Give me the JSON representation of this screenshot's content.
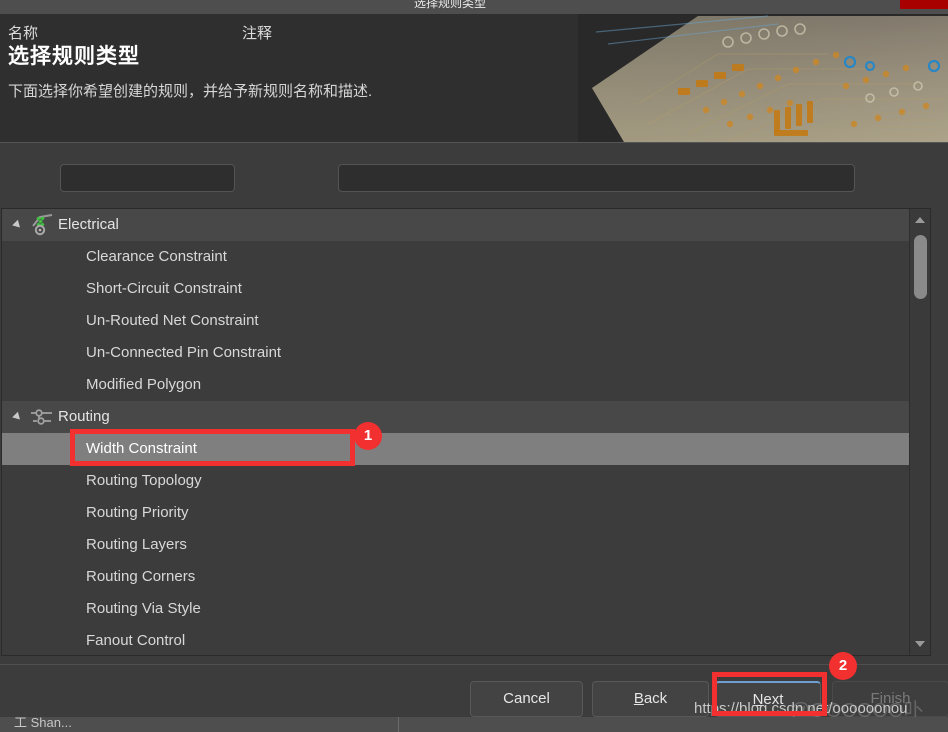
{
  "window": {
    "title": "选择规则类型",
    "close_icon": "close-icon"
  },
  "header": {
    "title": "选择规则类型",
    "subtitle": "下面选择你希望创建的规则，并给予新规则名称和描述.",
    "banner_icon": "pcb-circuit-board-image"
  },
  "fields": {
    "name_label": "名称",
    "name_value": "",
    "name_placeholder": "",
    "comment_label": "注释",
    "comment_value": "",
    "comment_placeholder": ""
  },
  "tree": {
    "groups": [
      {
        "label": "Electrical",
        "icon": "electrical-rule-icon",
        "expander_icon": "triangle-expanded-icon",
        "items": [
          "Clearance Constraint",
          "Short-Circuit Constraint",
          "Un-Routed Net Constraint",
          "Un-Connected Pin Constraint",
          "Modified Polygon"
        ]
      },
      {
        "label": "Routing",
        "icon": "routing-rule-icon",
        "expander_icon": "triangle-expanded-icon",
        "items": [
          "Width Constraint",
          "Routing Topology",
          "Routing Priority",
          "Routing Layers",
          "Routing Corners",
          "Routing Via Style",
          "Fanout Control"
        ]
      }
    ],
    "selected_item": "Width Constraint",
    "scrollbar": {
      "up_icon": "scroll-up-arrow-icon",
      "down_icon": "scroll-down-arrow-icon"
    }
  },
  "footer": {
    "cancel": "Cancel",
    "back_prefix": "",
    "back_accel": "B",
    "back_rest": "ack",
    "next_prefix": "",
    "next_accel": "N",
    "next_rest": "ext",
    "finish": "Finish"
  },
  "annotations": [
    {
      "badge": "1",
      "target": "Width Constraint"
    },
    {
      "badge": "2",
      "target": "Next"
    }
  ],
  "watermark": {
    "url": "https://blog.csdn.net/oooooonou",
    "logo": "@OOOOOO卟"
  },
  "bottom_strip": {
    "ghost_text": "工 Shan..."
  },
  "colors": {
    "window_bg": "#3c3c3c",
    "header_bg": "#2f2f2f",
    "group_row_bg": "#484848",
    "selected_row_bg": "#7f7f7f",
    "input_bg": "#2e2e2e",
    "annotation_red": "#f33030",
    "close_red": "#a80000",
    "focus_blue": "#6f9fd0"
  }
}
